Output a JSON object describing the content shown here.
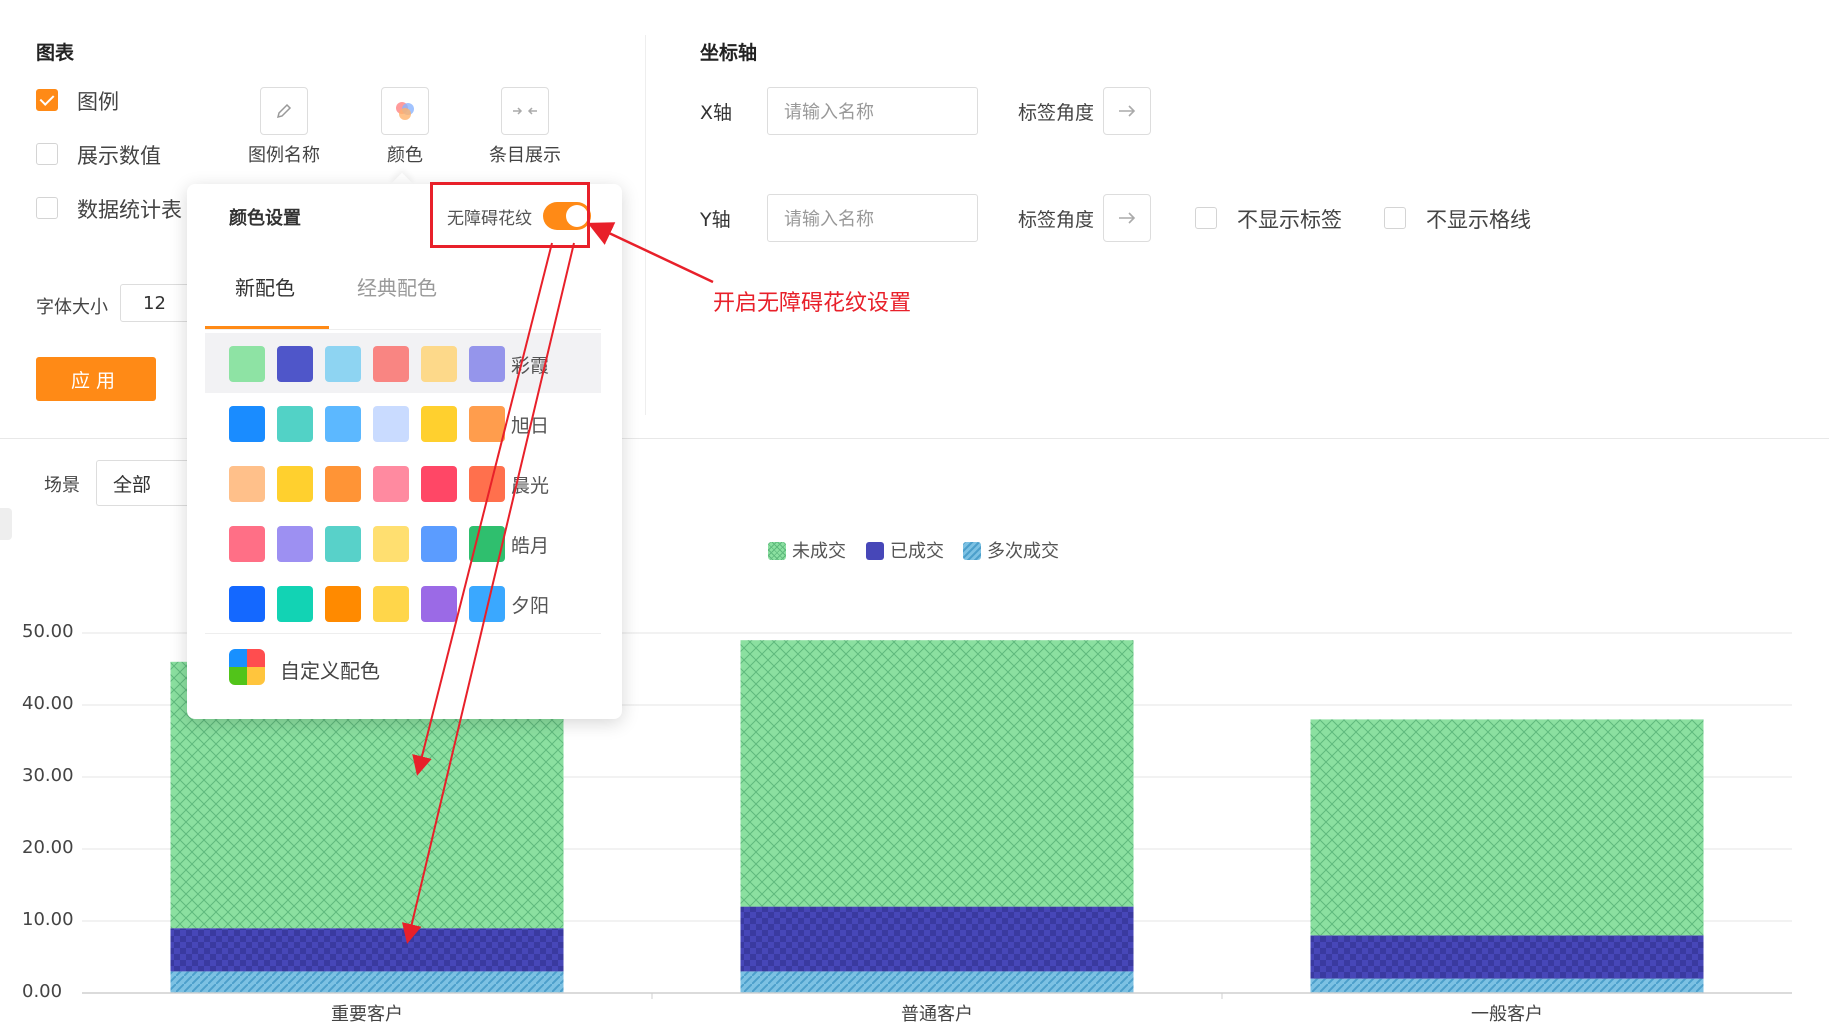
{
  "chart_panel": {
    "title": "图表",
    "checkboxes": [
      {
        "label": "图例",
        "checked": true
      },
      {
        "label": "展示数值",
        "checked": false
      },
      {
        "label": "数据统计表",
        "checked": false
      }
    ],
    "tools": [
      {
        "label": "图例名称",
        "icon": "pencil-icon"
      },
      {
        "label": "颜色",
        "icon": "palette-icon"
      },
      {
        "label": "条目展示",
        "icon": "collapse-arrows-icon"
      }
    ],
    "font_size_label": "字体大小",
    "font_size_value": "12",
    "apply_label": "应用"
  },
  "axis_panel": {
    "title": "坐标轴",
    "x_label": "X轴",
    "y_label": "Y轴",
    "name_placeholder": "请输入名称",
    "angle_label": "标签角度",
    "hide_labels": "不显示标签",
    "hide_gridlines": "不显示格线"
  },
  "scene": {
    "label": "场景",
    "value": "全部"
  },
  "color_popover": {
    "title": "颜色设置",
    "accessible_pattern_label": "无障碍花纹",
    "accessible_pattern_on": true,
    "tabs": [
      "新配色",
      "经典配色"
    ],
    "active_tab": 0,
    "palettes": [
      {
        "name": "彩霞",
        "colors": [
          "#8ee3a4",
          "#4f56c9",
          "#8ed4f2",
          "#f98582",
          "#fdd98a",
          "#9595eb"
        ]
      },
      {
        "name": "旭日",
        "colors": [
          "#1a8cff",
          "#52d2c6",
          "#5cb8ff",
          "#c9dbff",
          "#ffd02e",
          "#ff9d4d"
        ]
      },
      {
        "name": "晨光",
        "colors": [
          "#ffc08a",
          "#ffd02e",
          "#ff9436",
          "#ff8aa0",
          "#ff4766",
          "#ff704d"
        ]
      },
      {
        "name": "皓月",
        "colors": [
          "#ff6f86",
          "#9d90f2",
          "#58d1c9",
          "#ffdf70",
          "#5b9cff",
          "#2fbf6e"
        ]
      },
      {
        "name": "夕阳",
        "colors": [
          "#1468ff",
          "#12d3b4",
          "#ff8a00",
          "#ffd64a",
          "#9b6ae6",
          "#3aa8ff"
        ]
      }
    ],
    "custom_label": "自定义配色"
  },
  "annotation": "开启无障碍花纹设置",
  "chart_data": {
    "type": "bar",
    "stacked": true,
    "categories": [
      "重要客户",
      "普通客户",
      "一般客户"
    ],
    "series": [
      {
        "name": "多次成交",
        "values": [
          3,
          3,
          2
        ],
        "color": "#7cc1e3"
      },
      {
        "name": "已成交",
        "values": [
          6,
          9,
          6
        ],
        "color": "#4747b8"
      },
      {
        "name": "未成交",
        "values": [
          37,
          37,
          30
        ],
        "color": "#8be0a0"
      }
    ],
    "y_ticks": [
      "0.00",
      "10.00",
      "20.00",
      "30.00",
      "40.00",
      "50.00"
    ],
    "ylim": [
      0,
      50
    ],
    "legend_position": "top-center",
    "grid": true
  }
}
